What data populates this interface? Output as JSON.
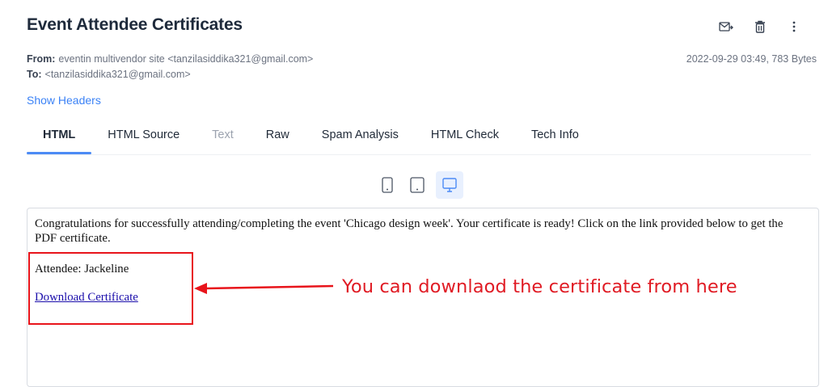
{
  "header": {
    "title": "Event Attendee Certificates",
    "actions": [
      {
        "icon": "forward-mail-icon"
      },
      {
        "icon": "trash-icon"
      },
      {
        "icon": "more-vertical-icon"
      }
    ]
  },
  "meta": {
    "from_label": "From:",
    "from_value": "eventin multivendor site <tanzilasiddika321@gmail.com>",
    "to_label": "To:",
    "to_value": "<tanzilasiddika321@gmail.com>",
    "date_size": "2022-09-29 03:49, 783 Bytes",
    "show_headers": "Show Headers"
  },
  "tabs": [
    {
      "label": "HTML",
      "state": "active"
    },
    {
      "label": "HTML Source",
      "state": "normal"
    },
    {
      "label": "Text",
      "state": "disabled"
    },
    {
      "label": "Raw",
      "state": "normal"
    },
    {
      "label": "Spam Analysis",
      "state": "normal"
    },
    {
      "label": "HTML Check",
      "state": "normal"
    },
    {
      "label": "Tech Info",
      "state": "normal"
    }
  ],
  "devices": [
    {
      "icon": "phone-icon",
      "active": false
    },
    {
      "icon": "tablet-icon",
      "active": false
    },
    {
      "icon": "desktop-icon",
      "active": true
    }
  ],
  "email": {
    "body": "Congratulations for successfully attending/completing the event 'Chicago design week'. Your certificate is ready! Click on the link provided below to get the PDF certificate.",
    "attendee": "Attendee: Jackeline",
    "download_link": "Download Certificate"
  },
  "annotation": {
    "text": "You can downlaod the certificate from here",
    "color": "#e01b24"
  },
  "colors": {
    "accent": "#4c8bf5",
    "link": "#3b82f6",
    "title": "#1e2a3b"
  }
}
